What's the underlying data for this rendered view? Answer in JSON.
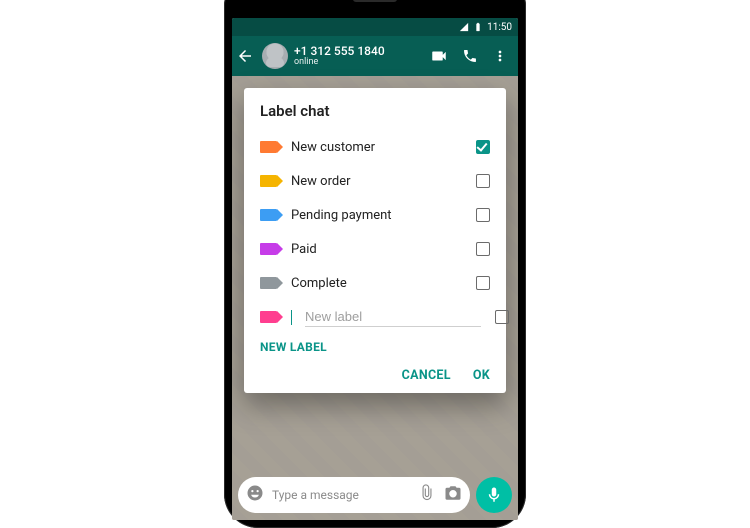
{
  "statusbar": {
    "time": "11:50"
  },
  "chat": {
    "phone_number": "+1 312 555 1840",
    "presence": "online"
  },
  "dialog": {
    "title": "Label chat",
    "labels": [
      {
        "name": "New customer",
        "color": "#ff7a32",
        "checked": true
      },
      {
        "name": "New order",
        "color": "#f5b400",
        "checked": false
      },
      {
        "name": "Pending payment",
        "color": "#3c9df3",
        "checked": false
      },
      {
        "name": "Paid",
        "color": "#c63ce8",
        "checked": false
      },
      {
        "name": "Complete",
        "color": "#8f979c",
        "checked": false
      }
    ],
    "new_label_color": "#ff3e8f",
    "new_label_placeholder": "New label",
    "new_label_button": "NEW LABEL",
    "cancel": "CANCEL",
    "ok": "OK"
  },
  "composer": {
    "placeholder": "Type a message"
  }
}
